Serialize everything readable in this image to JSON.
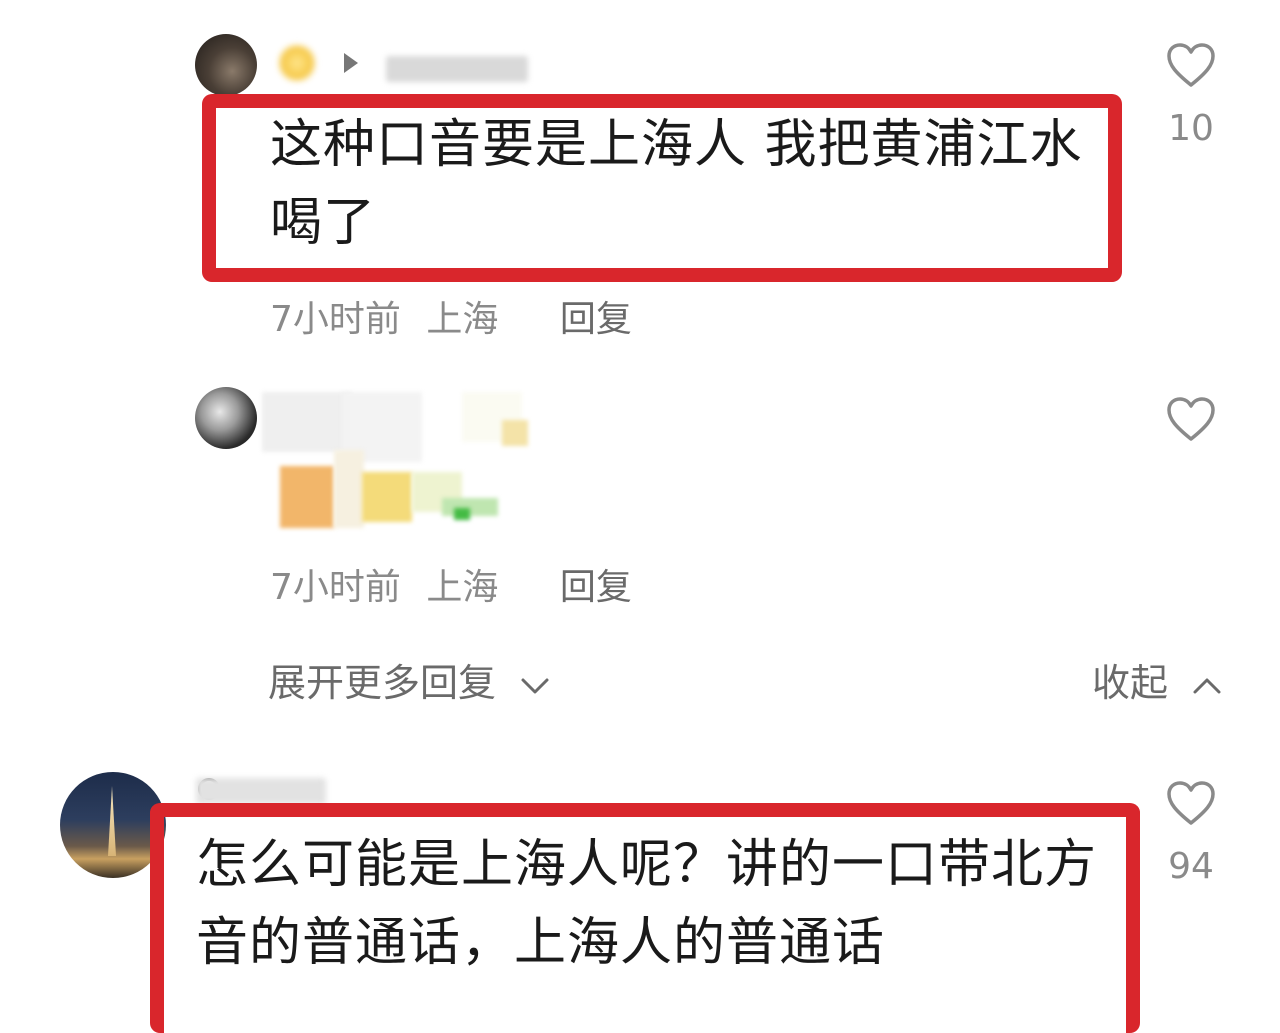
{
  "comments": [
    {
      "text": "这种口音要是上海人 我把黄浦江水喝了",
      "time": "7小时前",
      "location": "上海",
      "reply_label": "回复",
      "likes": "10"
    },
    {
      "text": "",
      "time": "7小时前",
      "location": "上海",
      "reply_label": "回复",
      "likes": ""
    },
    {
      "text": "怎么可能是上海人呢？讲的一口带北方音的普通话，上海人的普通话",
      "likes": "94"
    }
  ],
  "thread": {
    "expand_label": "展开更多回复",
    "collapse_label": "收起"
  },
  "colors": {
    "highlight": "#d9262c",
    "meta_text": "#8a8a8a"
  },
  "icons": [
    "heart-icon",
    "chevron-down-icon",
    "chevron-up-icon",
    "play-triangle-icon",
    "crown-badge-icon"
  ]
}
